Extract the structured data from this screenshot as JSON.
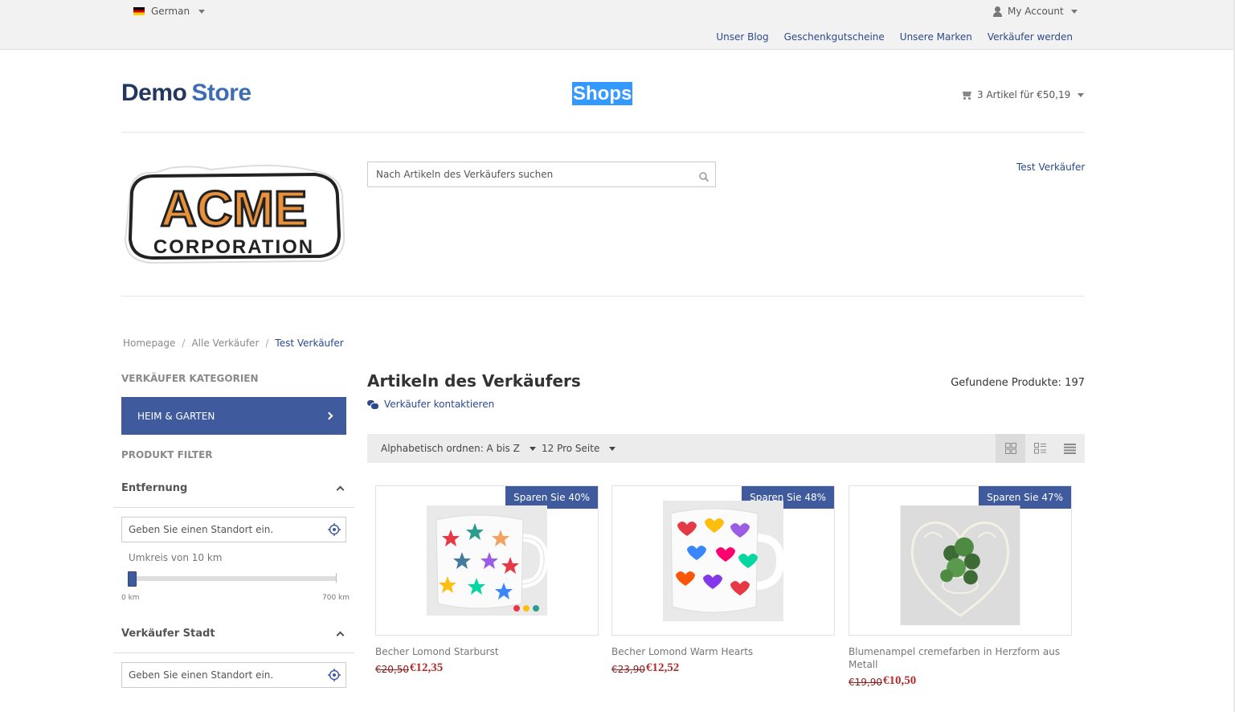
{
  "topbar": {
    "language": "German",
    "account": "My Account",
    "links": [
      "Unser Blog",
      "Geschenkgutscheine",
      "Unsere Marken",
      "Verkäufer werden"
    ]
  },
  "header": {
    "logo_demo": "Demo",
    "logo_store": "Store",
    "shops": "Shops",
    "cart": "3 Artikel für €50,19"
  },
  "vendor": {
    "logo_line1": "ACME",
    "logo_line2": "CORPORATION",
    "search_placeholder": "Nach Artikeln des Verkäufers suchen",
    "name_link": "Test Verkäufer"
  },
  "breadcrumb": [
    "Homepage",
    "Alle Verkäufer",
    "Test Verkäufer"
  ],
  "sidebar": {
    "categories_heading": "Verkäufer Kategorien",
    "category": "HEIM & GARTEN",
    "filter_heading": "Produkt Filter",
    "distance_title": "Entfernung",
    "location_placeholder": "Geben Sie einen Standort ein.",
    "radius_label": "Umkreis von 10 km",
    "radius_value_km": 10,
    "slider_min": "0 km",
    "slider_max": "700 km",
    "city_title": "Verkäufer Stadt",
    "city_placeholder": "Geben Sie einen Standort ein."
  },
  "main": {
    "title": "Artikeln des Verkäufers",
    "contact": "Verkäufer kontaktieren",
    "found": "Gefundene Produkte: 197",
    "sort": "Alphabetisch ordnen: A bis Z",
    "per_page": "12 Pro Seite"
  },
  "products": [
    {
      "badge": "Sparen Sie 40%",
      "name": "Becher Lomond Starburst",
      "old_price": "€20,50",
      "price": "€12,35"
    },
    {
      "badge": "Sparen Sie 48%",
      "name": "Becher Lomond Warm Hearts",
      "old_price": "€23,90",
      "price": "€12,52"
    },
    {
      "badge": "Sparen Sie 47%",
      "name": "Blumenampel cremefarben in Herzform aus Metall",
      "old_price": "€19,90",
      "price": "€10,50"
    }
  ],
  "colors": {
    "accent": "#3f5b9e",
    "link": "#2b4a8c",
    "price": "#b22d2d",
    "selection": "#3399ff"
  }
}
